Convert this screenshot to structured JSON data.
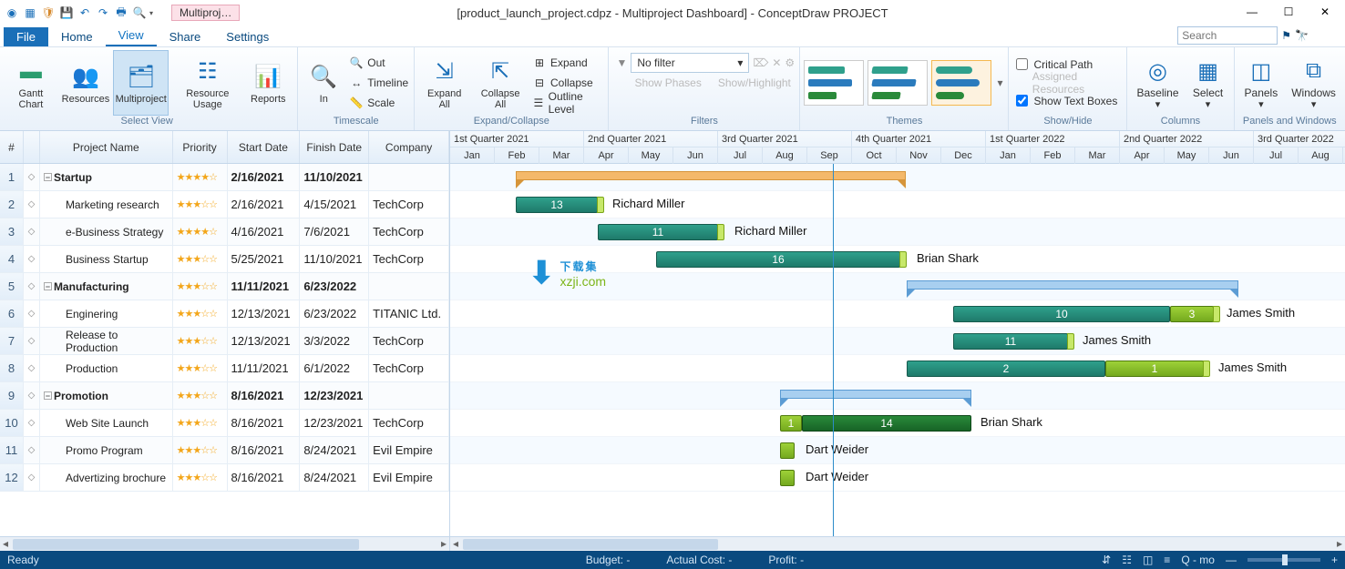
{
  "window": {
    "title": "[product_launch_project.cdpz - Multiproject Dashboard] - ConceptDraw PROJECT",
    "doc_tab": "Multiproj…",
    "search_placeholder": "Search"
  },
  "menu": {
    "file": "File",
    "home": "Home",
    "view": "View",
    "share": "Share",
    "settings": "Settings"
  },
  "ribbon": {
    "gantt": "Gantt\nChart",
    "resources": "Resources",
    "multiproject": "Multiproject",
    "resource_usage": "Resource\nUsage",
    "reports": "Reports",
    "in": "In",
    "out": "Out",
    "timeline": "Timeline",
    "scale": "Scale",
    "expand_all": "Expand\nAll",
    "collapse_all": "Collapse\nAll",
    "expand": "Expand",
    "collapse": "Collapse",
    "outline_level": "Outline Level",
    "filter": "No filter",
    "show_phases": "Show Phases",
    "show_highlight": "Show/Highlight",
    "critical_path": "Critical Path",
    "assigned_resources": "Assigned Resources",
    "show_text_boxes": "Show Text Boxes",
    "baseline": "Baseline",
    "select": "Select",
    "panels": "Panels",
    "windows": "Windows",
    "g_select_view": "Select View",
    "g_timescale": "Timescale",
    "g_expand": "Expand/Collapse",
    "g_filters": "Filters",
    "g_themes": "Themes",
    "g_showhide": "Show/Hide",
    "g_columns": "Columns",
    "g_panels": "Panels and Windows"
  },
  "grid": {
    "h_num": "#",
    "h_name": "Project Name",
    "h_priority": "Priority",
    "h_start": "Start Date",
    "h_finish": "Finish Date",
    "h_company": "Company"
  },
  "rows": [
    {
      "n": "1",
      "name": "Startup",
      "lvl": 0,
      "bold": true,
      "pri": "★★★★☆",
      "sd": "2/16/2021",
      "fd": "11/10/2021",
      "comp": ""
    },
    {
      "n": "2",
      "name": "Marketing research",
      "lvl": 1,
      "pri": "★★★☆☆",
      "sd": "2/16/2021",
      "fd": "4/15/2021",
      "comp": "TechCorp"
    },
    {
      "n": "3",
      "name": "e-Business Strategy",
      "lvl": 1,
      "pri": "★★★★☆",
      "sd": "4/16/2021",
      "fd": "7/6/2021",
      "comp": "TechCorp"
    },
    {
      "n": "4",
      "name": "Business Startup",
      "lvl": 1,
      "pri": "★★★☆☆",
      "sd": "5/25/2021",
      "fd": "11/10/2021",
      "comp": "TechCorp"
    },
    {
      "n": "5",
      "name": "Manufacturing",
      "lvl": 0,
      "bold": true,
      "pri": "★★★☆☆",
      "sd": "11/11/2021",
      "fd": "6/23/2022",
      "comp": ""
    },
    {
      "n": "6",
      "name": "Enginering",
      "lvl": 1,
      "pri": "★★★☆☆",
      "sd": "12/13/2021",
      "fd": "6/23/2022",
      "comp": "TITANIC Ltd."
    },
    {
      "n": "7",
      "name": "Release to Production",
      "lvl": 1,
      "pri": "★★★☆☆",
      "sd": "12/13/2021",
      "fd": "3/3/2022",
      "comp": "TechCorp"
    },
    {
      "n": "8",
      "name": "Production",
      "lvl": 1,
      "pri": "★★★☆☆",
      "sd": "11/11/2021",
      "fd": "6/1/2022",
      "comp": "TechCorp"
    },
    {
      "n": "9",
      "name": "Promotion",
      "lvl": 0,
      "bold": true,
      "pri": "★★★☆☆",
      "sd": "8/16/2021",
      "fd": "12/23/2021",
      "comp": ""
    },
    {
      "n": "10",
      "name": "Web Site Launch",
      "lvl": 1,
      "pri": "★★★☆☆",
      "sd": "8/16/2021",
      "fd": "12/23/2021",
      "comp": "TechCorp"
    },
    {
      "n": "11",
      "name": "Promo Program",
      "lvl": 1,
      "pri": "★★★☆☆",
      "sd": "8/16/2021",
      "fd": "8/24/2021",
      "comp": "Evil Empire"
    },
    {
      "n": "12",
      "name": "Advertizing brochure",
      "lvl": 1,
      "pri": "★★★☆☆",
      "sd": "8/16/2021",
      "fd": "8/24/2021",
      "comp": "Evil Empire"
    }
  ],
  "timeline": {
    "quarters": [
      "1st Quarter 2021",
      "2nd Quarter 2021",
      "3rd Quarter 2021",
      "4th Quarter 2021",
      "1st Quarter 2022",
      "2nd Quarter 2022",
      "3rd Quarter 2022"
    ],
    "months": [
      "Jan",
      "Feb",
      "Mar",
      "Apr",
      "May",
      "Jun",
      "Jul",
      "Aug",
      "Sep",
      "Oct",
      "Nov",
      "Dec",
      "Jan",
      "Feb",
      "Mar",
      "Apr",
      "May",
      "Jun",
      "Jul",
      "Aug"
    ]
  },
  "bars": {
    "r2_val": "13",
    "r2_lbl": "Richard Miller",
    "r3_val": "11",
    "r3_lbl": "Richard Miller",
    "r4_val": "16",
    "r4_lbl": "Brian Shark",
    "r6_a": "10",
    "r6_b": "3",
    "r6_lbl": "James Smith",
    "r7_val": "11",
    "r7_lbl": "James Smith",
    "r8_a": "2",
    "r8_b": "1",
    "r8_lbl": "James Smith",
    "r10_a": "1",
    "r10_b": "14",
    "r10_lbl": "Brian Shark",
    "r11_lbl": "Dart Weider",
    "r12_lbl": "Dart Weider"
  },
  "status": {
    "ready": "Ready",
    "budget": "Budget: -",
    "actual": "Actual Cost: -",
    "profit": "Profit: -",
    "unit": "Q - mo"
  },
  "watermark": {
    "cn": "下载集",
    "en": "xzji.com"
  }
}
